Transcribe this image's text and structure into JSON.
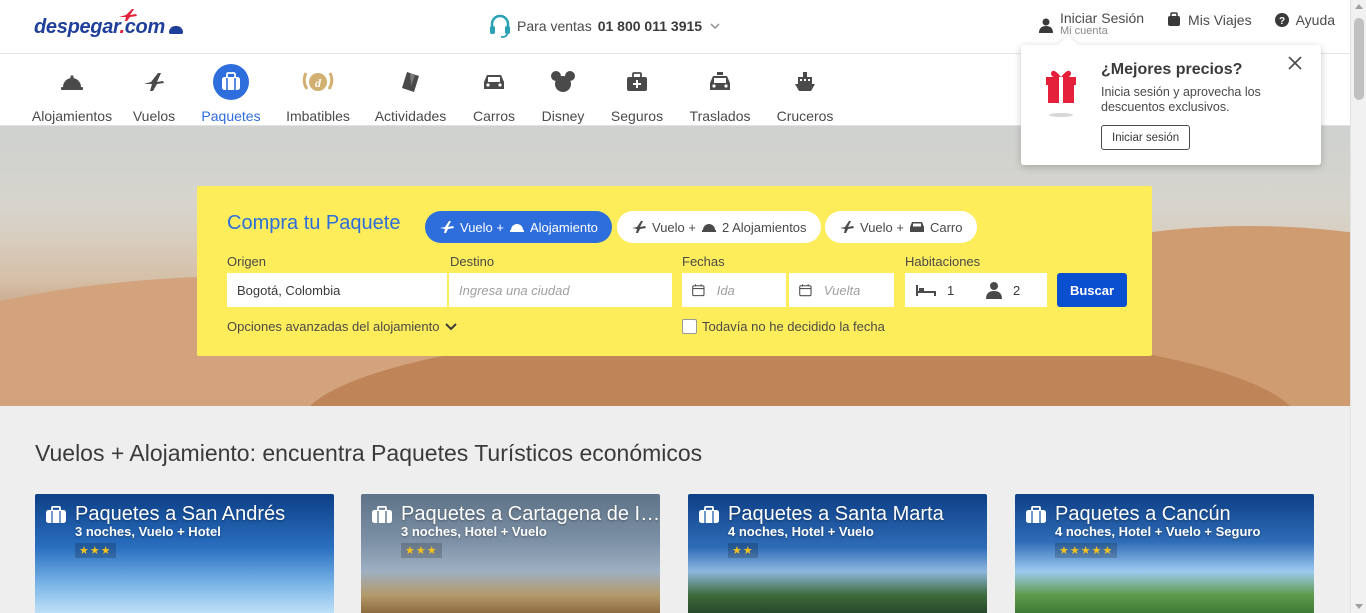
{
  "header": {
    "logo_text": "despegar",
    "logo_dot": "com",
    "sales_label": "Para ventas",
    "sales_phone": "01 800 011 3915",
    "login_label": "Iniciar Sesión",
    "login_sub": "Mi cuenta",
    "trips_label": "Mis Viajes",
    "help_label": "Ayuda"
  },
  "categories": [
    {
      "label": "Alojamientos",
      "icon": "hotel-bell-icon"
    },
    {
      "label": "Vuelos",
      "icon": "plane-icon"
    },
    {
      "label": "Paquetes",
      "icon": "suitcase-icon",
      "active": true
    },
    {
      "label": "Imbatibles",
      "icon": "laurel-badge-icon"
    },
    {
      "label": "Actividades",
      "icon": "ticket-icon"
    },
    {
      "label": "Carros",
      "icon": "car-icon"
    },
    {
      "label": "Disney",
      "icon": "mickey-icon"
    },
    {
      "label": "Seguros",
      "icon": "medical-case-icon"
    },
    {
      "label": "Traslados",
      "icon": "taxi-icon"
    },
    {
      "label": "Cruceros",
      "icon": "ship-icon"
    }
  ],
  "search": {
    "title": "Compra tu Paquete",
    "options": [
      {
        "label": "Vuelo + ",
        "label2": "Alojamiento",
        "active": true
      },
      {
        "label": "Vuelo + ",
        "label2": "2 Alojamientos",
        "active": false
      },
      {
        "label": "Vuelo + ",
        "label2": "Carro",
        "active": false
      }
    ],
    "origin_label": "Origen",
    "origin_value": "Bogotá, Colombia",
    "destination_label": "Destino",
    "destination_placeholder": "Ingresa una ciudad",
    "dates_label": "Fechas",
    "depart_placeholder": "Ida",
    "return_placeholder": "Vuelta",
    "rooms_label": "Habitaciones",
    "rooms_value": "1",
    "guests_value": "2",
    "search_button": "Buscar",
    "advanced_label": "Opciones avanzadas del alojamiento",
    "undecided_label": "Todavía no he decidido la fecha"
  },
  "section": {
    "title": "Vuelos + Alojamiento: encuentra Paquetes Turísticos económicos"
  },
  "cards": [
    {
      "title": "Paquetes a San Andrés",
      "subtitle": "3 noches, Vuelo + Hotel",
      "stars": "★★★",
      "stars_count": 3
    },
    {
      "title": "Paquetes a Cartagena de Indias",
      "subtitle": "3 noches, Hotel + Vuelo",
      "stars": "★★★",
      "stars_count": 3
    },
    {
      "title": "Paquetes a Santa Marta",
      "subtitle": "4 noches, Hotel + Vuelo",
      "stars": "★★",
      "stars_count": 2
    },
    {
      "title": "Paquetes a Cancún",
      "subtitle": "4 noches, Hotel + Vuelo + Seguro",
      "stars": "★★★★★",
      "stars_count": 5
    }
  ],
  "popup": {
    "title": "¿Mejores precios?",
    "text": "Inicia sesión y aprovecha los descuentos exclusivos.",
    "button": "Iniciar sesión"
  },
  "colors": {
    "brand_blue": "#1f3f9a",
    "accent_blue": "#2e6ddc",
    "search_yellow": "#fded5b",
    "button_blue": "#0b4fd1",
    "star_yellow": "#f7c21b"
  }
}
